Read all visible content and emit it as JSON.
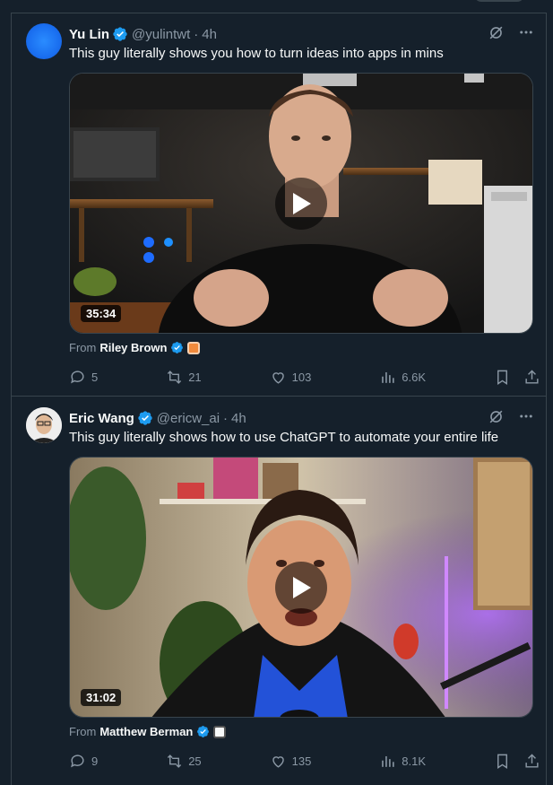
{
  "tweets": [
    {
      "author": "Yu Lin",
      "handle": "@yulintwt",
      "time": "4h",
      "text": "This guy literally shows you how to turn ideas into apps in mins",
      "video": {
        "duration": "35:34"
      },
      "from_label": "From",
      "from_name": "Riley Brown",
      "stats": {
        "replies": "5",
        "reposts": "21",
        "likes": "103",
        "views": "6.6K"
      }
    },
    {
      "author": "Eric Wang",
      "handle": "@ericw_ai",
      "time": "4h",
      "text": "This guy literally shows how to use ChatGPT to automate your entire life",
      "video": {
        "duration": "31:02"
      },
      "from_label": "From",
      "from_name": "Matthew Berman",
      "stats": {
        "replies": "9",
        "reposts": "25",
        "likes": "135",
        "views": "8.1K"
      }
    }
  ],
  "separator": "·",
  "colors": {
    "background": "#15202b",
    "border": "#38444d",
    "muted": "#8b98a5",
    "verified": "#1d9bf0"
  },
  "icons": [
    "grok-icon",
    "more-icon",
    "verified-icon",
    "play-icon",
    "reply-icon",
    "repost-icon",
    "like-icon",
    "views-icon",
    "bookmark-icon",
    "share-icon"
  ]
}
